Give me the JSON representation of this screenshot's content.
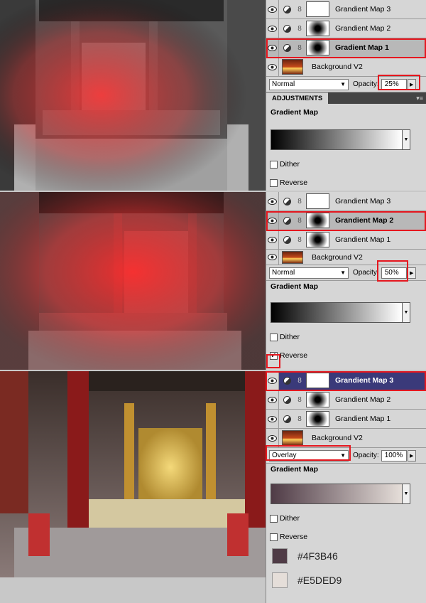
{
  "layers": {
    "gm3": "Grandient Map 3",
    "gm2": "Grandient Map 2",
    "gm1": "Gradient Map 1",
    "gm1_alt": "Grandient Map 1",
    "bg": "Background V2"
  },
  "panel1": {
    "blend_mode": "Normal",
    "opacity_label": "Opacity:",
    "opacity": "25%",
    "tab": "ADJUSTMENTS",
    "adj_title": "Gradient Map",
    "dither": "Dither",
    "reverse": "Reverse",
    "gradient_from": "#000000",
    "gradient_to": "#ffffff"
  },
  "panel2": {
    "blend_mode": "Normal",
    "opacity_label": "Opacity:",
    "opacity": "50%",
    "adj_title": "Gradient Map",
    "dither": "Dither",
    "reverse": "Reverse",
    "gradient_from": "#000000",
    "gradient_to": "#ffffff"
  },
  "panel3": {
    "blend_mode": "Overlay",
    "opacity_label": "Opacity:",
    "opacity": "100%",
    "adj_title": "Gradient Map",
    "dither": "Dither",
    "reverse": "Reverse",
    "color1": "#4F3B46",
    "color2": "#E5DED9"
  },
  "colors": {
    "highlight": "#e5171f",
    "selected_layer": "#3a3a7a"
  }
}
